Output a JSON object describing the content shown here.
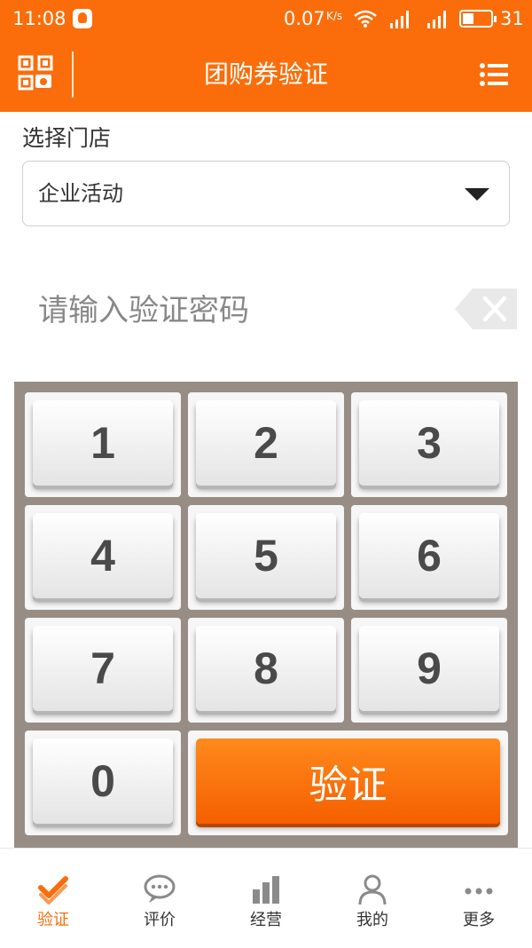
{
  "status_bar": {
    "time": "11:08",
    "speed": "0.07",
    "speed_unit": "K/s",
    "battery": "31"
  },
  "header": {
    "title": "团购券验证",
    "left_icon": "qr-scan-icon",
    "right_icon": "menu-icon"
  },
  "store": {
    "label": "选择门店",
    "selected": "企业活动"
  },
  "code": {
    "value": "",
    "placeholder": "请输入验证密码"
  },
  "keypad": {
    "keys": [
      "1",
      "2",
      "3",
      "4",
      "5",
      "6",
      "7",
      "8",
      "9",
      "0"
    ],
    "verify_label": "验证"
  },
  "tabs": [
    {
      "label": "验证",
      "icon": "verify-icon",
      "active": true
    },
    {
      "label": "评价",
      "icon": "comment-icon",
      "active": false
    },
    {
      "label": "经营",
      "icon": "bar-chart-icon",
      "active": false
    },
    {
      "label": "我的",
      "icon": "user-icon",
      "active": false
    },
    {
      "label": "更多",
      "icon": "more-icon",
      "active": false
    }
  ],
  "colors": {
    "brand": "#fa6d0a",
    "keypad_bg": "#978d84"
  }
}
